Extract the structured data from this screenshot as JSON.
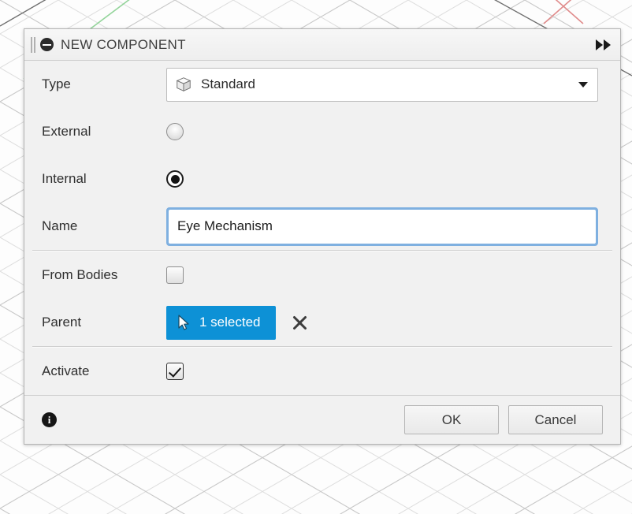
{
  "background": {
    "kind": "cad-isometric-grid",
    "axis_colors": {
      "x": "#d86b6b",
      "y": "#7fc27f",
      "grid": "#cfcfcf"
    }
  },
  "dialog": {
    "title": "NEW COMPONENT",
    "collapse_icon": "minus-circle-icon",
    "grip_icon": "drag-grip-icon",
    "expand_icon": "fast-forward-icon",
    "rows": {
      "type": {
        "label": "Type",
        "value": "Standard",
        "icon": "cube-icon",
        "caret": "chevron-down-icon"
      },
      "external": {
        "label": "External",
        "checked": false
      },
      "internal": {
        "label": "Internal",
        "checked": true
      },
      "name": {
        "label": "Name",
        "value": "Eye Mechanism",
        "placeholder": "Name"
      },
      "from_bodies": {
        "label": "From Bodies",
        "checked": false
      },
      "parent": {
        "label": "Parent",
        "button_label": "1 selected",
        "button_icon": "cursor-arrow-icon",
        "clear_icon": "close-x-icon",
        "accent_color": "#0d91d6"
      },
      "activate": {
        "label": "Activate",
        "checked": true
      }
    },
    "footer": {
      "info_icon": "info-icon",
      "info_glyph": "i",
      "ok_label": "OK",
      "cancel_label": "Cancel"
    }
  }
}
